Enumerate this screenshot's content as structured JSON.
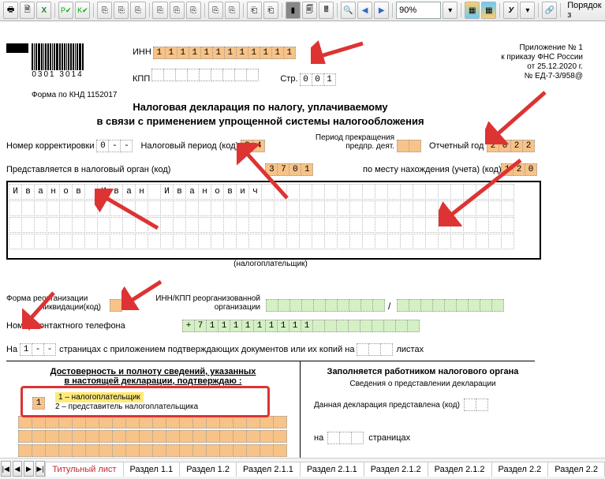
{
  "toolbar": {
    "zoom": "90%",
    "order": "Порядок з"
  },
  "appendix": {
    "l1": "Приложение № 1",
    "l2": "к приказу ФНС России",
    "l3": "от 25.12.2020 г.",
    "l4": "№  ЕД-7-3/958@"
  },
  "barcode": "0301 3014",
  "formcode": "Форма по КНД 1152017",
  "inn_label": "ИНН",
  "inn": [
    "1",
    "1",
    "1",
    "1",
    "1",
    "1",
    "1",
    "1",
    "1",
    "1",
    "1",
    "1"
  ],
  "kpp_label": "КПП",
  "kpp": [
    "",
    "",
    "",
    "",
    "",
    "",
    "",
    "",
    ""
  ],
  "page_label": "Стр.",
  "page_no": [
    "0",
    "0",
    "1"
  ],
  "title1": "Налоговая декларация по налогу, уплачиваемому",
  "title2": "в связи с применением упрощенной системы налогообложения",
  "corr_label": "Номер корректировки",
  "corr": [
    "0",
    "-",
    "-"
  ],
  "period_label": "Налоговый период  (код)",
  "period": [
    "3",
    "4"
  ],
  "term_label": "Период прекращения",
  "term_label2": "предпр. деят.",
  "term": [
    "",
    ""
  ],
  "year_label": "Отчетный год",
  "year": [
    "2",
    "0",
    "2",
    "2"
  ],
  "submit_label": "Представляется в налоговый орган   (код)",
  "submit": [
    "3",
    "7",
    "0",
    "1"
  ],
  "place_label": "по месту нахождения (учета)  (код)",
  "place": [
    "1",
    "2",
    "0"
  ],
  "name": "Иванов Иван Иванович",
  "taxpayer_type": "(налогоплательщик)",
  "reorg_label1": "Форма реорганизации",
  "reorg_label2": "пиквидации(код)",
  "reorg": [
    ""
  ],
  "reorg_inn_label1": "ИНН/КПП реорганизованной",
  "reorg_inn_label2": "организации",
  "reorg_inn": [
    "",
    "",
    "",
    "",
    "",
    "",
    "",
    "",
    "",
    ""
  ],
  "reorg_kpp": [
    "",
    "",
    "",
    "",
    "",
    "",
    "",
    "",
    ""
  ],
  "phone_label": "Номер контактного телефона",
  "phone": [
    "+",
    "7",
    "1",
    "1",
    "1",
    "1",
    "1",
    "1",
    "1",
    "1",
    "1",
    "",
    "",
    "",
    "",
    "",
    "",
    "",
    "",
    ""
  ],
  "pages_l1": "На",
  "pages_v": [
    "1",
    "-",
    "-"
  ],
  "pages_l2": "страницах с приложением подтверждающих документов или их копий на",
  "pages_v2": [
    "",
    "",
    ""
  ],
  "pages_l3": "листах",
  "confirm_hdr1": "Достоверность и полноту сведений, указанных",
  "confirm_hdr2": "в настоящей декларации, подтверждаю :",
  "confirm_sel": [
    "1"
  ],
  "confirm_opt1": "1 – налогоплательщик",
  "confirm_opt2": "2 – представитель налогоплательщика",
  "filled_hdr": "Заполняется работником налогового органа",
  "filled_sub": "Сведения о представлении декларации",
  "filled_l1": "Данная декларация представлена   (код)",
  "filled_c1": [
    "",
    ""
  ],
  "filled_l2": "на",
  "filled_c2": [
    "",
    "",
    ""
  ],
  "filled_l3": "страницах",
  "tabs": {
    "t0": "Титульный лист",
    "t1": "Раздел 1.1",
    "t2": "Раздел 1.2",
    "t3": "Раздел 2.1.1",
    "t4": "Раздел 2.1.1",
    "t5": "Раздел 2.1.2",
    "t6": "Раздел 2.1.2",
    "t7": "Раздел 2.2",
    "t8": "Раздел 2.2"
  }
}
